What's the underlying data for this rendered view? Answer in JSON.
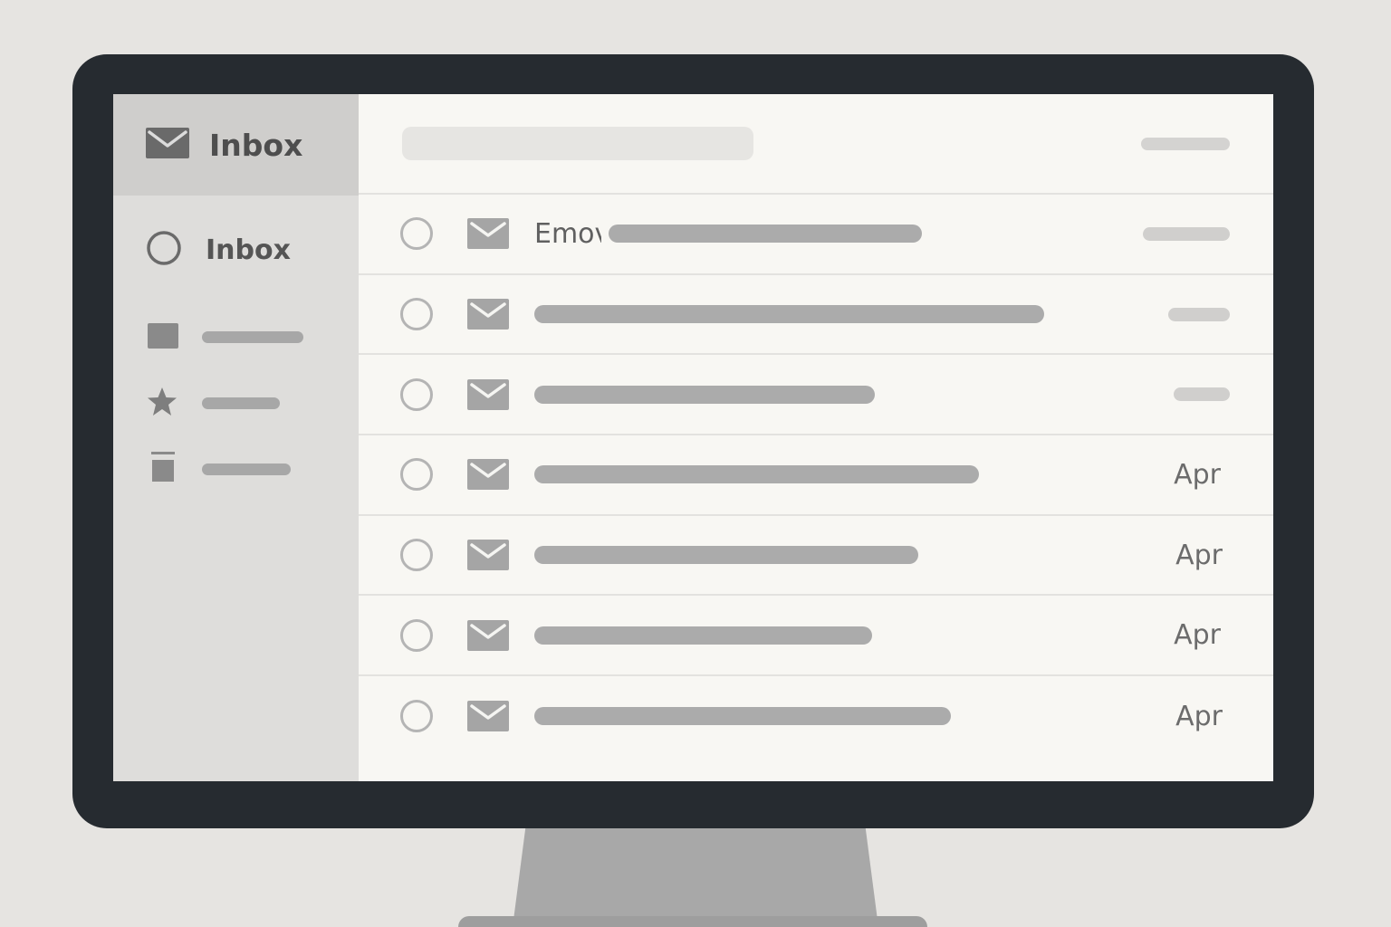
{
  "app": {
    "header_title": "Inbox",
    "header_icon": "envelope-icon"
  },
  "sidebar": {
    "items": [
      {
        "label": "Inbox",
        "icon": "circle-icon"
      },
      {
        "label": "",
        "icon": "square-icon"
      },
      {
        "label": "",
        "icon": "star-icon"
      },
      {
        "label": "",
        "icon": "trash-icon"
      }
    ]
  },
  "messages": [
    {
      "subject": "Emov",
      "date": ""
    },
    {
      "subject": "",
      "date": ""
    },
    {
      "subject": "",
      "date": ""
    },
    {
      "subject": "",
      "date": "Apr"
    },
    {
      "subject": "",
      "date": "Apr"
    },
    {
      "subject": "",
      "date": "Apr"
    },
    {
      "subject": "",
      "date": "Apr"
    }
  ],
  "colors": {
    "bezel": "#262b30",
    "screen": "#f8f7f3",
    "sidebar": "#dedddb",
    "sidebar_header": "#cfcecc",
    "placeholder_bar": "#ababab"
  }
}
